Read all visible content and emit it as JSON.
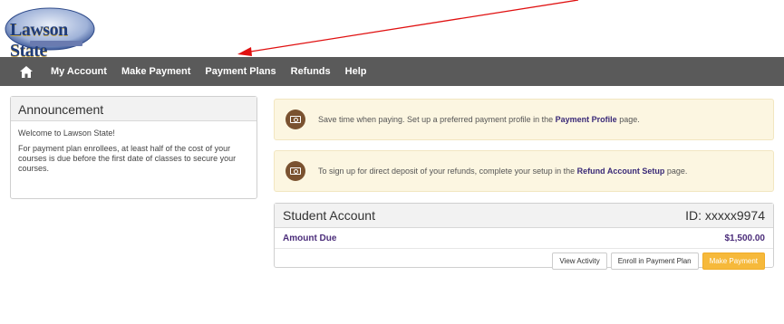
{
  "logo": {
    "text": "Lawson State"
  },
  "nav": {
    "home_icon": "home-icon",
    "items": [
      "My Account",
      "Make Payment",
      "Payment Plans",
      "Refunds",
      "Help"
    ]
  },
  "announcement": {
    "title": "Announcement",
    "lines": [
      "Welcome to Lawson State!",
      "For payment plan enrollees, at least half of the cost of your courses is due before the first date of classes to secure your courses."
    ]
  },
  "alerts": [
    {
      "icon": "money-icon",
      "pre": "Save time when paying. Set up a preferred payment profile in the ",
      "link": "Payment Profile",
      "post": " page."
    },
    {
      "icon": "money-icon",
      "pre": "To sign up for direct deposit of your refunds, complete your setup in the ",
      "link": "Refund Account Setup",
      "post": " page."
    }
  ],
  "account": {
    "title": "Student Account",
    "id": "ID: xxxxx9974",
    "amount_label": "Amount Due",
    "amount_value": "$1,500.00",
    "buttons": {
      "view_activity": "View Activity",
      "enroll": "Enroll in Payment Plan",
      "make_payment": "Make Payment"
    }
  },
  "colors": {
    "navbar": "#5a5a5a",
    "alert_bg": "#fcf6e1",
    "accent_purple": "#4b2d7a",
    "primary_button": "#f6b93b",
    "annotation_arrow": "#e01010"
  }
}
